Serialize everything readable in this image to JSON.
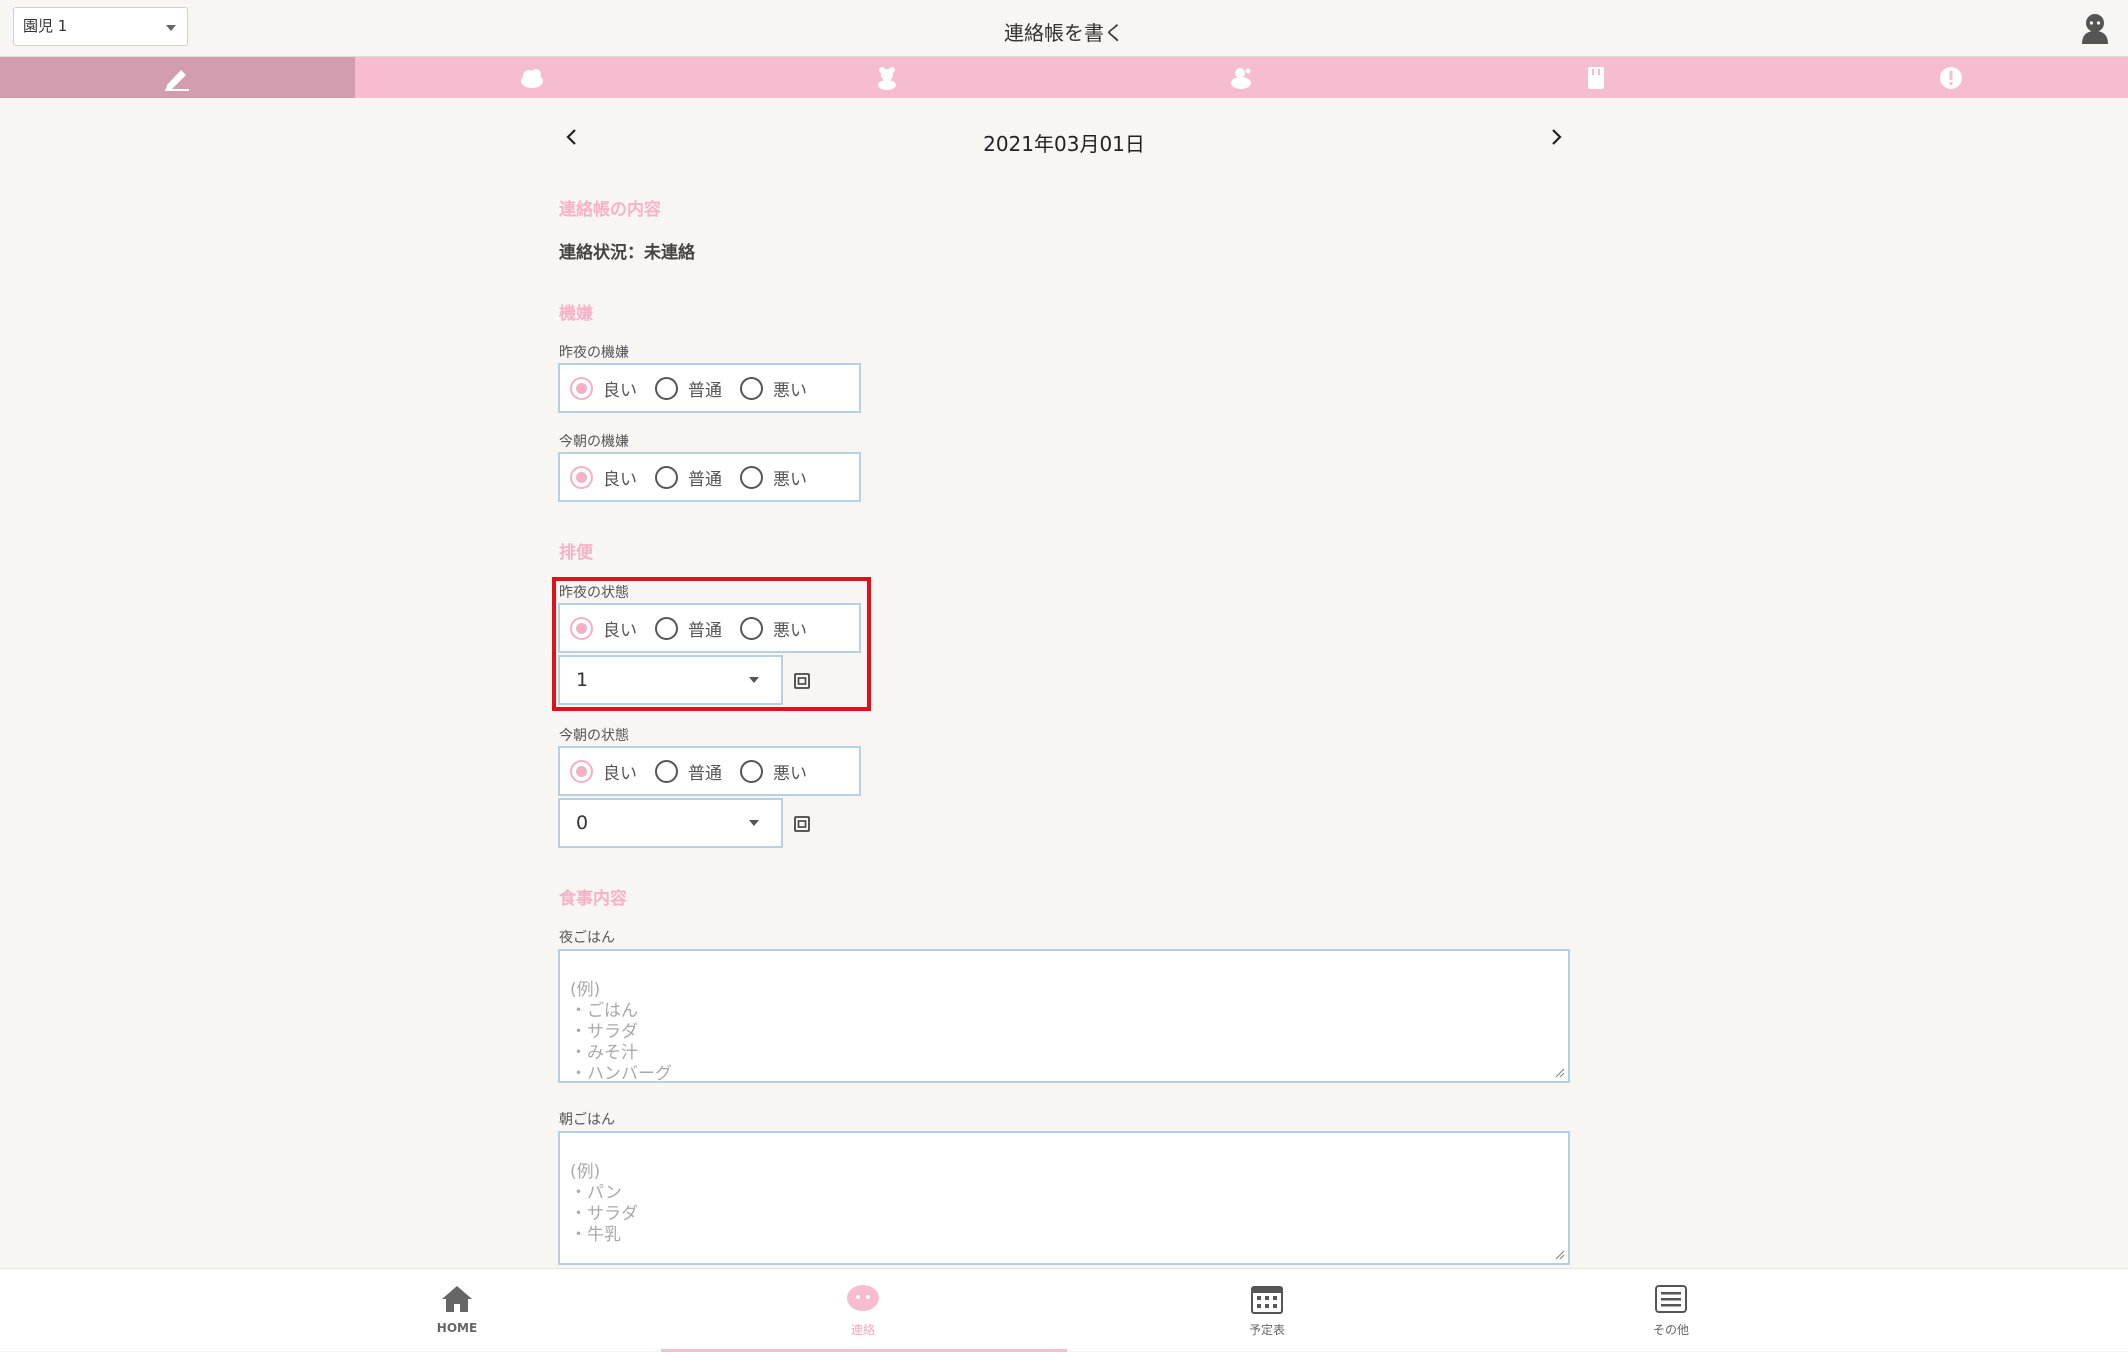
{
  "topbar": {
    "child_select": "園児 1",
    "title": "連絡帳を書く"
  },
  "tabs": [
    {
      "icon": "pencil-icon",
      "active": true
    },
    {
      "icon": "cloud-icon",
      "active": false
    },
    {
      "icon": "bear-icon",
      "active": false
    },
    {
      "icon": "animal-icon",
      "active": false
    },
    {
      "icon": "notebook-icon",
      "active": false
    },
    {
      "icon": "alert-icon",
      "active": false
    }
  ],
  "date": "2021年03月01日",
  "sections": {
    "content_title": "連絡帳の内容",
    "status": "連絡状況：未連絡",
    "mood_title": "機嫌",
    "bowel_title": "排便",
    "meal_title": "食事内容"
  },
  "mood": {
    "last_night_label": "昨夜の機嫌",
    "this_morning_label": "今朝の機嫌"
  },
  "bowel": {
    "last_night_label": "昨夜の状態",
    "last_night_count": "1",
    "this_morning_label": "今朝の状態",
    "this_morning_count": "0"
  },
  "radio_options": {
    "good": "良い",
    "normal": "普通",
    "bad": "悪い"
  },
  "meals": {
    "dinner_label": "夜ごはん",
    "dinner_placeholder": "(例)\n・ごはん\n・サラダ\n・みそ汁\n・ハンバーグ",
    "breakfast_label": "朝ごはん",
    "breakfast_placeholder": "(例)\n・パン\n・サラダ\n・牛乳"
  },
  "bottom_nav": {
    "home": "HOME",
    "contact": "連絡",
    "schedule": "予定表",
    "other": "その他"
  },
  "colors": {
    "accent_pink": "#f6bdd0",
    "active_tab": "#d29daf",
    "section_title": "#f6b3c8",
    "border_blue": "#b6d0e6",
    "highlight_red": "#e0101c"
  }
}
